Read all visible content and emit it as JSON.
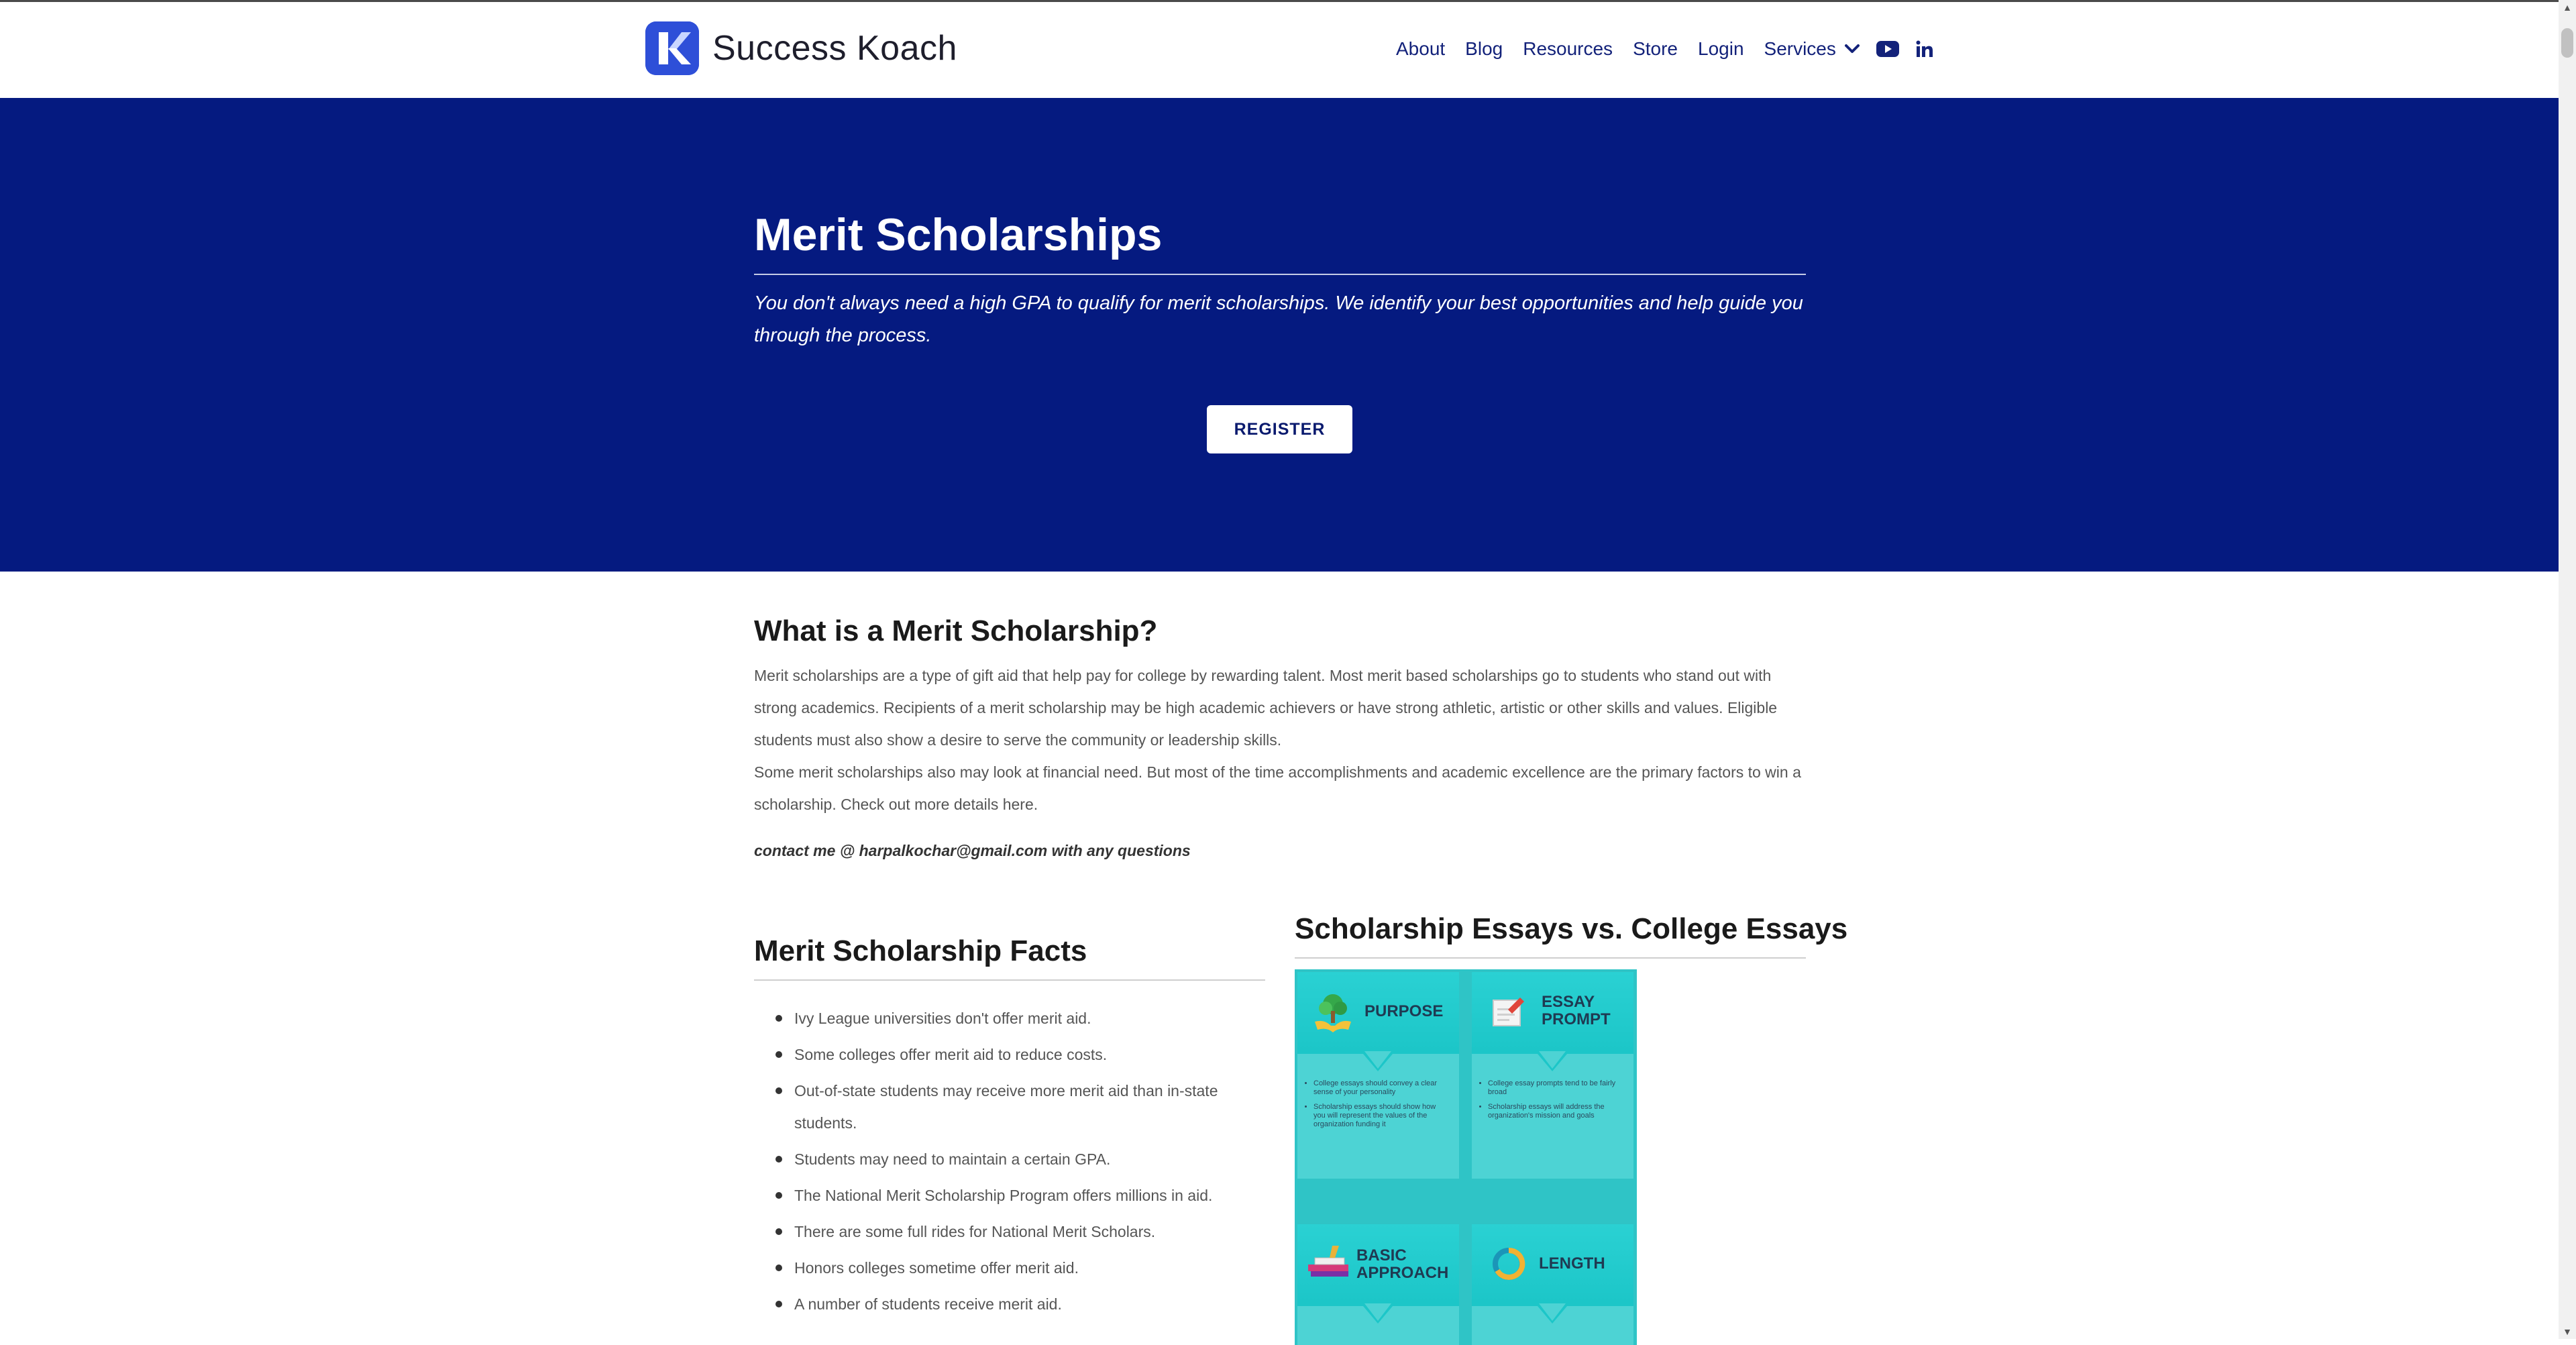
{
  "header": {
    "brand": "Success Koach",
    "nav": {
      "about": "About",
      "blog": "Blog",
      "resources": "Resources",
      "store": "Store",
      "login": "Login",
      "services": "Services"
    },
    "icons": [
      "chevron-down-icon",
      "youtube-icon",
      "linkedin-icon"
    ]
  },
  "hero": {
    "title": "Merit Scholarships",
    "subtitle": "You don't always need a high GPA to qualify for merit scholarships. We identify your best opportunities and help guide you through the process.",
    "register_label": "REGISTER"
  },
  "what": {
    "title": "What is a Merit Scholarship?",
    "p1": "Merit scholarships are a type of gift aid that help pay for college by rewarding talent. Most merit based scholarships go to students who stand out with strong academics. Recipients of a merit scholarship may be high academic achievers or have strong athletic, artistic or other skills and values. Eligible students must also show a desire to serve the community or leadership skills.",
    "p2": "Some merit scholarships also may look at financial need. But most of the time accomplishments and academic excellence are the primary factors to win a scholarship. Check out more details here.",
    "contact": "contact me @ harpalkochar@gmail.com with any questions"
  },
  "facts": {
    "title": "Merit Scholarship Facts",
    "items": [
      "Ivy League universities don't offer merit aid.",
      "Some colleges offer merit aid to reduce costs.",
      "Out-of-state students may receive more merit aid than in-state students.",
      "Students may need to maintain a certain GPA.",
      "The National Merit Scholarship Program offers millions in aid.",
      "There are some full rides for National Merit Scholars.",
      "Honors colleges sometime offer merit aid.",
      "A number of students receive merit aid."
    ]
  },
  "essays": {
    "title": "Scholarship Essays vs. College Essays",
    "tiles": {
      "purpose": {
        "title": "PURPOSE",
        "b1": "College essays should convey a clear sense of your personality",
        "b2": "Scholarship essays should show how you will represent the values of the organization funding it"
      },
      "prompt": {
        "title1": "ESSAY",
        "title2": "PROMPT",
        "b1": "College essay prompts tend to be fairly broad",
        "b2": "Scholarship essays will address the organization's mission and goals"
      },
      "basic": {
        "title1": "BASIC",
        "title2": "APPROACH"
      },
      "length": {
        "title": "LENGTH"
      }
    }
  },
  "colors": {
    "brand_blue": "#051a80",
    "nav_text": "#13227a",
    "logo_blue": "#2e4fd8",
    "infographic_teal": "#2fc4c6"
  }
}
